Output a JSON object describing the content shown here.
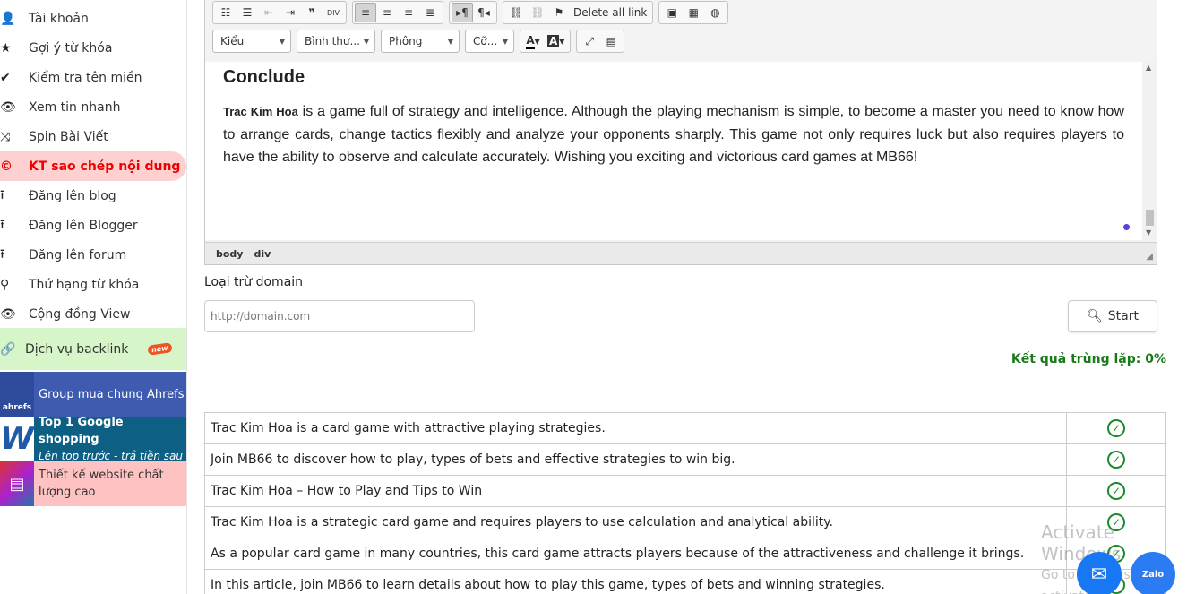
{
  "sidebar": {
    "items": [
      {
        "icon": "user-icon",
        "glyph": "👤",
        "label": "Tài khoản"
      },
      {
        "icon": "star-icon",
        "glyph": "★",
        "label": "Gợi ý từ khóa"
      },
      {
        "icon": "check-icon",
        "glyph": "✔",
        "label": "Kiểm tra tên miền"
      },
      {
        "icon": "eye-icon",
        "glyph": "👁",
        "label": "Xem tin nhanh"
      },
      {
        "icon": "shuffle-icon",
        "glyph": "⤨",
        "label": "Spin Bài Viết"
      },
      {
        "icon": "copyright-icon",
        "glyph": "©",
        "label": "KT sao chép nội dung"
      },
      {
        "icon": "upload-icon",
        "glyph": "⭱",
        "label": "Đăng lên blog"
      },
      {
        "icon": "upload-icon",
        "glyph": "⭱",
        "label": "Đăng lên Blogger"
      },
      {
        "icon": "upload-icon",
        "glyph": "⭱",
        "label": "Đăng lên forum"
      },
      {
        "icon": "search-icon",
        "glyph": "⚲",
        "label": "Thứ hạng từ khóa"
      },
      {
        "icon": "eye-icon",
        "glyph": "👁",
        "label": "Cộng đồng View"
      }
    ],
    "backlink": {
      "icon": "link-icon",
      "glyph": "🔗",
      "label": "Dịch vụ backlink",
      "badge": "new"
    },
    "promos": [
      {
        "thumb": "ahrefs",
        "text": "Group mua chung Ahrefs",
        "bg": "#3f5bb0"
      },
      {
        "thumb": "",
        "title": "Top 1 Google shopping",
        "subtitle": "Lên top trước - trả tiền sau",
        "bg": "#0d5f84"
      },
      {
        "thumb": "",
        "text": "Thiết kế website chất lượng cao",
        "bg": "#ffc2c2"
      }
    ]
  },
  "toolbar": {
    "delete_all_link": "Delete all link",
    "combos": [
      "Kiểu",
      "Bình thư...",
      "Phông",
      "Cỡ..."
    ]
  },
  "editor": {
    "heading": "Conclude",
    "para_bold": "Trac Kim Hoa",
    "para_text": " is a game full of strategy and intelligence. Although the playing mechanism is simple, to become a master you need to know how to arrange cards, change tactics flexibly and analyze your opponents sharply. This game not only requires luck but also requires players to have the ability to observe and calculate accurately. Wishing you exciting and victorious card games at MB66!",
    "path": [
      "body",
      "div"
    ]
  },
  "domain": {
    "label": "Loại trừ domain",
    "placeholder": "http://domain.com",
    "start_label": "Start"
  },
  "result": {
    "text": "Kết quả trùng lặp: 0%"
  },
  "rows": [
    "Trac Kim Hoa is a card game with attractive playing strategies.",
    "Join MB66 to discover how to play, types of bets and effective strategies to win big.",
    "Trac Kim Hoa – How to Play and Tips to Win",
    "Trac Kim Hoa is a strategic card game and requires players to use calculation and analytical ability.",
    "As a popular card game in many countries, this card game attracts players because of the attractiveness and challenge it brings.",
    "In this article, join MB66 to learn details about how to play this game, types of bets and winning strategies."
  ],
  "watermark": {
    "line1": "Activate Windows",
    "line2": "Go to Settings to activate"
  },
  "floating": {
    "zalo": "Zalo"
  }
}
